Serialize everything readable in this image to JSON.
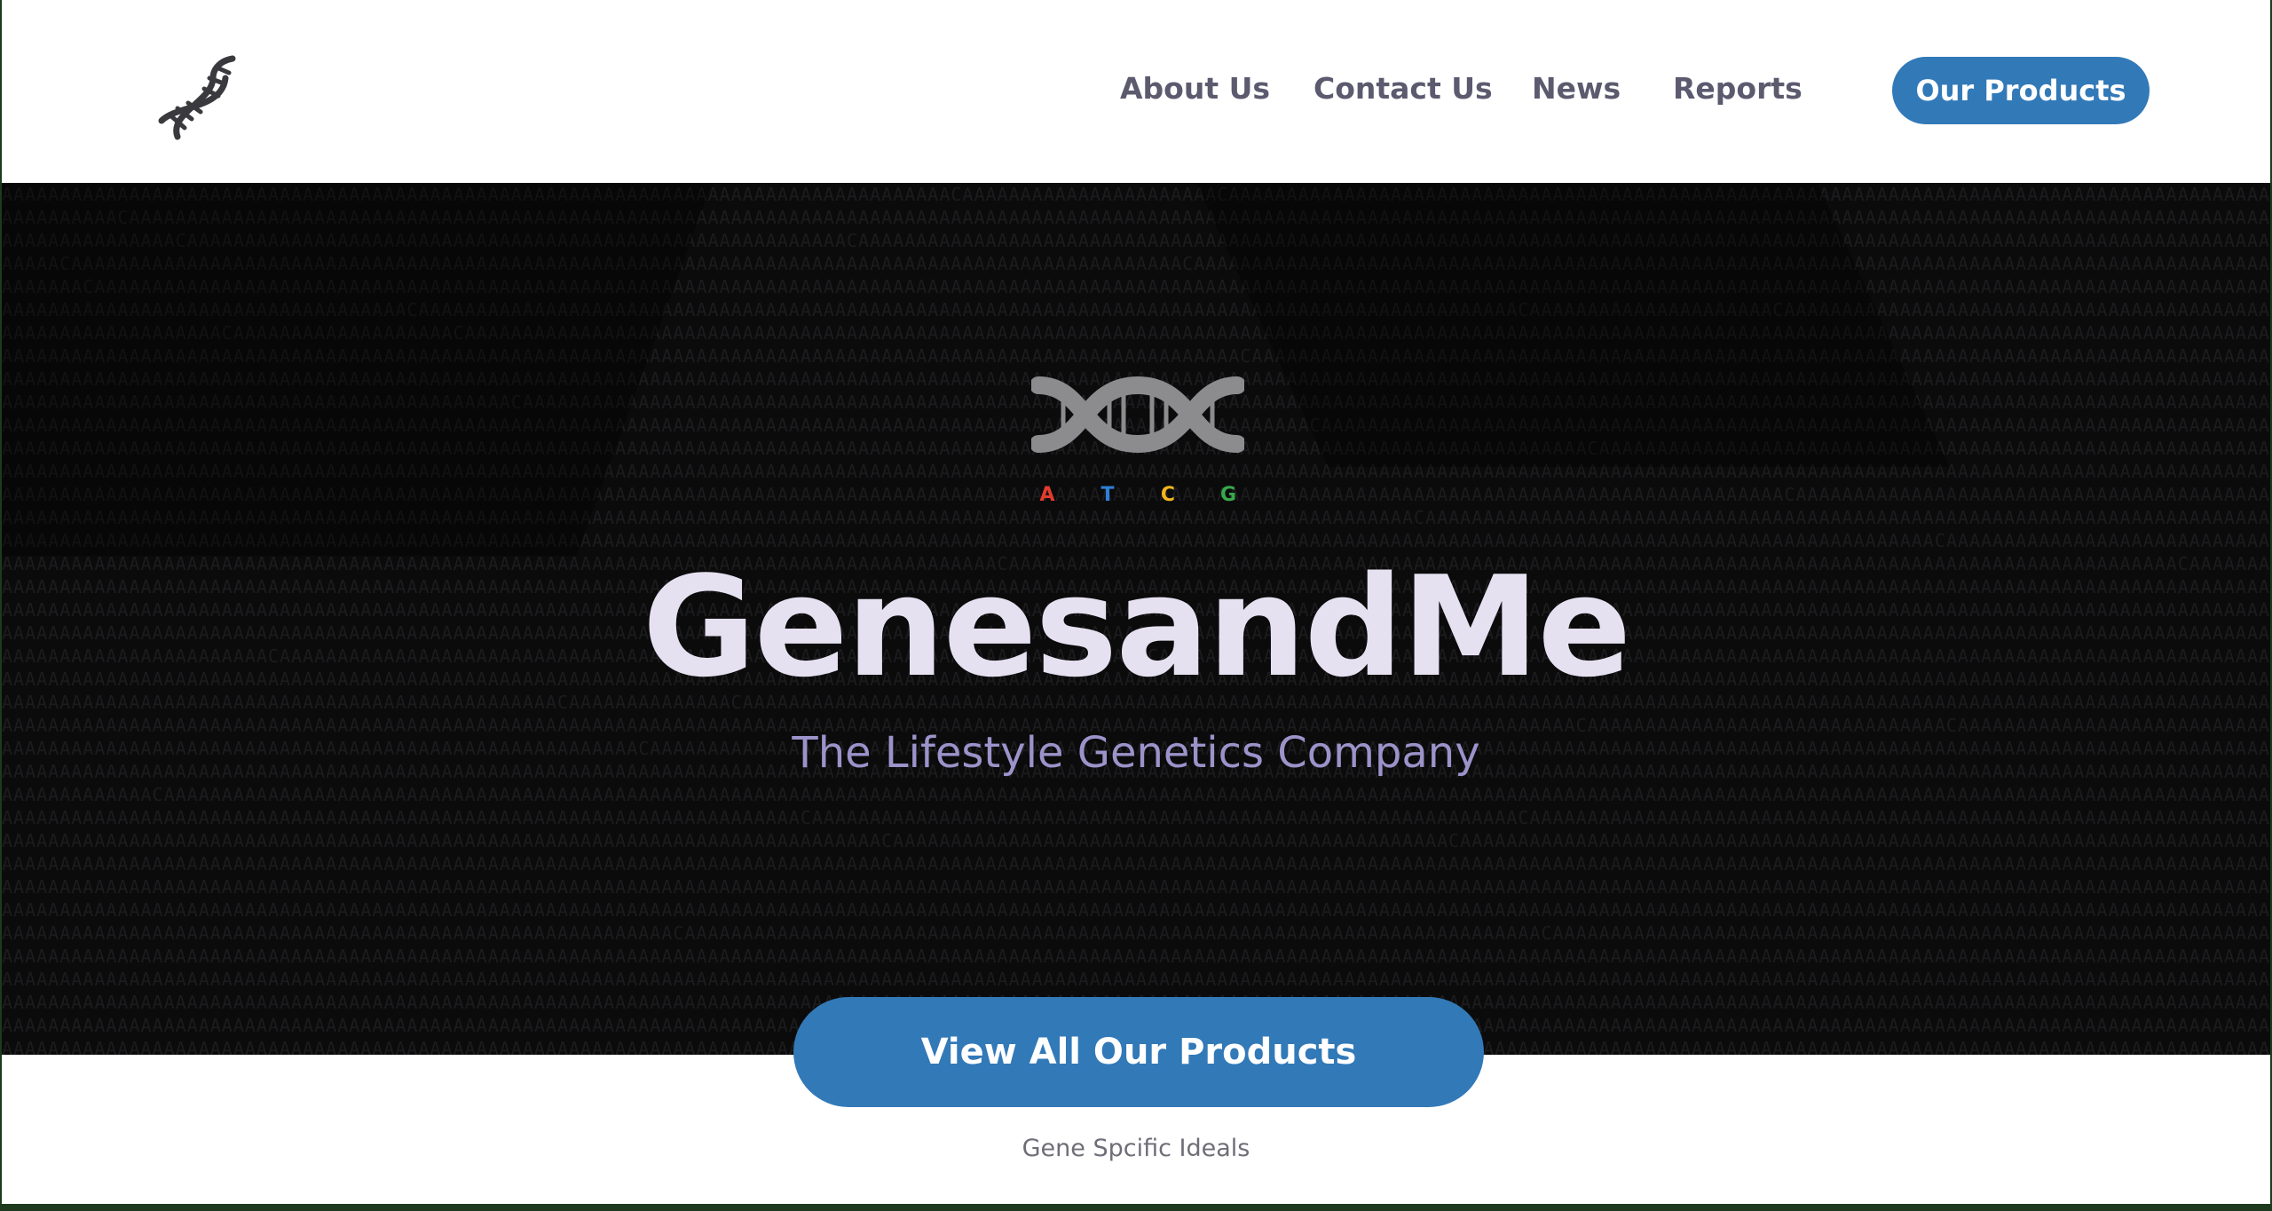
{
  "nav": {
    "logo_icon": "dna-helix-icon",
    "links": [
      "About Us",
      "Contact Us",
      "News",
      "Reports"
    ],
    "cta_label": "Our Products",
    "cta_color": "#3279b8",
    "link_color": "#5b5a6e"
  },
  "hero": {
    "emblem_icon": "dna-helix-icon",
    "emblem_letters": [
      "A",
      "T",
      "C",
      "G"
    ],
    "emblem_letter_colors": [
      "#e23b2e",
      "#2f7fd6",
      "#f2b51c",
      "#37a94b"
    ],
    "title": "GenesandMe",
    "subtitle": "The Lifestyle Genetics Company",
    "cta_label": "View All Our Products",
    "background_color": "#0b0b0c"
  },
  "footer": {
    "tagline": "Gene Spcific Ideals"
  }
}
